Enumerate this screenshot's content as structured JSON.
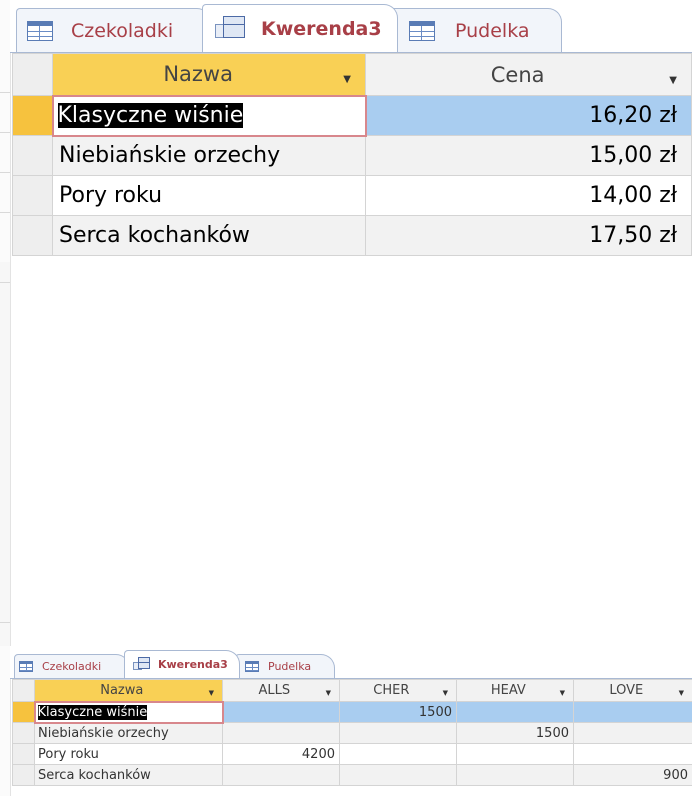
{
  "top": {
    "tabs": [
      {
        "label": "Czekoladki",
        "icon": "table-icon"
      },
      {
        "label": "Kwerenda3",
        "icon": "query-icon",
        "active": true
      },
      {
        "label": "Pudelka",
        "icon": "table-icon"
      }
    ],
    "headers": [
      "Nazwa",
      "Cena"
    ],
    "rows": [
      {
        "nazwa": "Klasyczne wiśnie",
        "cena": "16,20 zł"
      },
      {
        "nazwa": "Niebiańskie orzechy",
        "cena": "15,00 zł"
      },
      {
        "nazwa": "Pory roku",
        "cena": "14,00 zł"
      },
      {
        "nazwa": "Serca kochanków",
        "cena": "17,50 zł"
      }
    ]
  },
  "bottom": {
    "tabs": [
      {
        "label": "Czekoladki",
        "icon": "table-icon"
      },
      {
        "label": "Kwerenda3",
        "icon": "query-icon",
        "active": true
      },
      {
        "label": "Pudelka",
        "icon": "table-icon"
      }
    ],
    "headers": [
      "Nazwa",
      "ALLS",
      "CHER",
      "HEAV",
      "LOVE"
    ],
    "rows": [
      {
        "nazwa": "Klasyczne wiśnie",
        "alls": "",
        "cher": "1500",
        "heav": "",
        "love": ""
      },
      {
        "nazwa": "Niebiańskie orzechy",
        "alls": "",
        "cher": "",
        "heav": "1500",
        "love": ""
      },
      {
        "nazwa": "Pory roku",
        "alls": "4200",
        "cher": "",
        "heav": "",
        "love": ""
      },
      {
        "nazwa": "Serca kochanków",
        "alls": "",
        "cher": "",
        "heav": "",
        "love": "900"
      }
    ]
  },
  "colors": {
    "tab_text": "#a83f47",
    "header_highlight": "#f9d055",
    "row_selector_current": "#f6c23e",
    "row_highlight": "#a9cdf0",
    "active_cell_border": "#d8878c",
    "tab_border": "#a9b9d3"
  }
}
